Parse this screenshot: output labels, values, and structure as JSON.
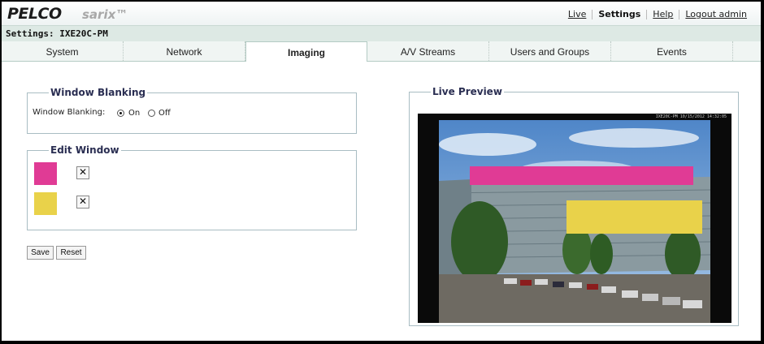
{
  "header": {
    "logo": "PELCO",
    "product": "sarix™",
    "nav": [
      {
        "label": "Live",
        "active": false
      },
      {
        "label": "Settings",
        "active": true
      },
      {
        "label": "Help",
        "active": false
      },
      {
        "label": "Logout admin",
        "active": false
      }
    ]
  },
  "settings_bar": {
    "label": "Settings: IXE20C-PM"
  },
  "tabs": [
    "System",
    "Network",
    "Imaging",
    "A/V Streams",
    "Users and Groups",
    "Events"
  ],
  "selected_tab": "Imaging",
  "window_blanking": {
    "legend": "Window Blanking",
    "field_label": "Window Blanking:",
    "options": [
      "On",
      "Off"
    ],
    "selected": "On"
  },
  "edit_window": {
    "legend": "Edit Window",
    "windows": [
      {
        "color": "#e03b95",
        "delete_glyph": "✕"
      },
      {
        "color": "#e9d24a",
        "delete_glyph": "✕"
      }
    ]
  },
  "buttons": {
    "save": "Save",
    "reset": "Reset"
  },
  "live_preview": {
    "legend": "Live Preview",
    "osd_text": "IXE20C-PM 10/15/2012 14:32:05"
  }
}
